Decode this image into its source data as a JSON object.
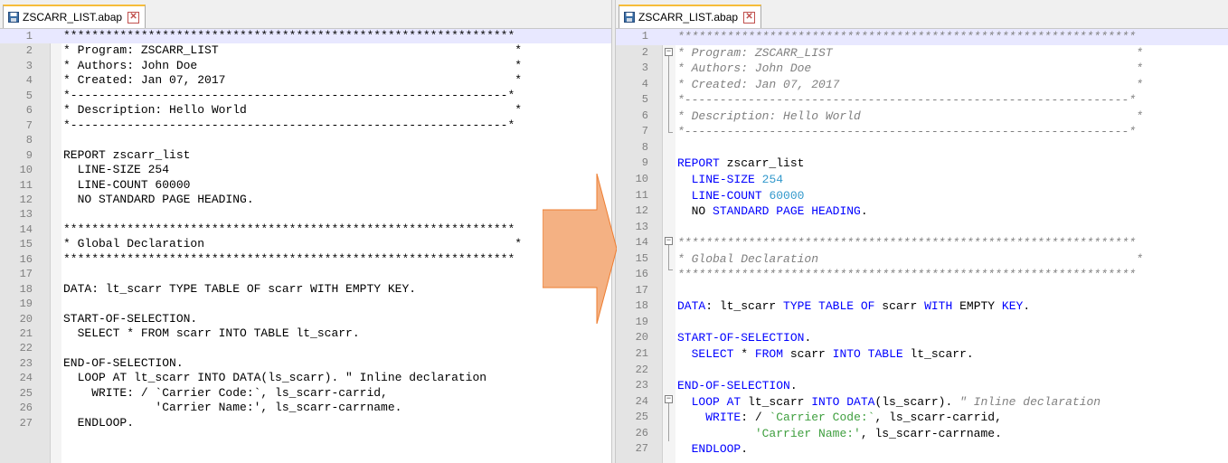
{
  "left": {
    "tab_label": "ZSCARR_LIST.abap",
    "lines": [
      {
        "n": "1",
        "spans": [
          {
            "c": "plain",
            "t": "****************************************************************"
          }
        ]
      },
      {
        "n": "2",
        "spans": [
          {
            "c": "plain",
            "t": "* Program: ZSCARR_LIST                                          *"
          }
        ]
      },
      {
        "n": "3",
        "spans": [
          {
            "c": "plain",
            "t": "* Authors: John Doe                                             *"
          }
        ]
      },
      {
        "n": "4",
        "spans": [
          {
            "c": "plain",
            "t": "* Created: Jan 07, 2017                                         *"
          }
        ]
      },
      {
        "n": "5",
        "spans": [
          {
            "c": "plain",
            "t": "*--------------------------------------------------------------*"
          }
        ]
      },
      {
        "n": "6",
        "spans": [
          {
            "c": "plain",
            "t": "* Description: Hello World                                      *"
          }
        ]
      },
      {
        "n": "7",
        "spans": [
          {
            "c": "plain",
            "t": "*--------------------------------------------------------------*"
          }
        ]
      },
      {
        "n": "8",
        "spans": []
      },
      {
        "n": "9",
        "spans": [
          {
            "c": "plain",
            "t": "REPORT zscarr_list"
          }
        ]
      },
      {
        "n": "10",
        "spans": [
          {
            "c": "plain",
            "t": "  LINE-SIZE 254"
          }
        ]
      },
      {
        "n": "11",
        "spans": [
          {
            "c": "plain",
            "t": "  LINE-COUNT 60000"
          }
        ]
      },
      {
        "n": "12",
        "spans": [
          {
            "c": "plain",
            "t": "  NO STANDARD PAGE HEADING."
          }
        ]
      },
      {
        "n": "13",
        "spans": []
      },
      {
        "n": "14",
        "spans": [
          {
            "c": "plain",
            "t": "****************************************************************"
          }
        ]
      },
      {
        "n": "15",
        "spans": [
          {
            "c": "plain",
            "t": "* Global Declaration                                            *"
          }
        ]
      },
      {
        "n": "16",
        "spans": [
          {
            "c": "plain",
            "t": "****************************************************************"
          }
        ]
      },
      {
        "n": "17",
        "spans": []
      },
      {
        "n": "18",
        "spans": [
          {
            "c": "plain",
            "t": "DATA: lt_scarr TYPE TABLE OF scarr WITH EMPTY KEY."
          }
        ]
      },
      {
        "n": "19",
        "spans": []
      },
      {
        "n": "20",
        "spans": [
          {
            "c": "plain",
            "t": "START-OF-SELECTION."
          }
        ]
      },
      {
        "n": "21",
        "spans": [
          {
            "c": "plain",
            "t": "  SELECT * FROM scarr INTO TABLE lt_scarr."
          }
        ]
      },
      {
        "n": "22",
        "spans": []
      },
      {
        "n": "23",
        "spans": [
          {
            "c": "plain",
            "t": "END-OF-SELECTION."
          }
        ]
      },
      {
        "n": "24",
        "spans": [
          {
            "c": "plain",
            "t": "  LOOP AT lt_scarr INTO DATA(ls_scarr). \" Inline declaration"
          }
        ]
      },
      {
        "n": "25",
        "spans": [
          {
            "c": "plain",
            "t": "    WRITE: / `Carrier Code:`, ls_scarr-carrid,"
          }
        ]
      },
      {
        "n": "26",
        "spans": [
          {
            "c": "plain",
            "t": "             'Carrier Name:', ls_scarr-carrname."
          }
        ]
      },
      {
        "n": "27",
        "spans": [
          {
            "c": "plain",
            "t": "  ENDLOOP."
          }
        ]
      }
    ]
  },
  "right": {
    "tab_label": "ZSCARR_LIST.abap",
    "lines": [
      {
        "n": "1",
        "spans": [
          {
            "c": "cmt",
            "t": "*****************************************************************"
          }
        ]
      },
      {
        "n": "2",
        "spans": [
          {
            "c": "cmt",
            "t": "* Program: ZSCARR_LIST                                           *"
          }
        ]
      },
      {
        "n": "3",
        "spans": [
          {
            "c": "cmt",
            "t": "* Authors: John Doe                                              *"
          }
        ]
      },
      {
        "n": "4",
        "spans": [
          {
            "c": "cmt",
            "t": "* Created: Jan 07, 2017                                          *"
          }
        ]
      },
      {
        "n": "5",
        "spans": [
          {
            "c": "cmt",
            "t": "*---------------------------------------------------------------*"
          }
        ]
      },
      {
        "n": "6",
        "spans": [
          {
            "c": "cmt",
            "t": "* Description: Hello World                                       *"
          }
        ]
      },
      {
        "n": "7",
        "spans": [
          {
            "c": "cmt",
            "t": "*---------------------------------------------------------------*"
          }
        ]
      },
      {
        "n": "8",
        "spans": []
      },
      {
        "n": "9",
        "spans": [
          {
            "c": "kw",
            "t": "REPORT"
          },
          {
            "c": "plain",
            "t": " zscarr_list"
          }
        ]
      },
      {
        "n": "10",
        "spans": [
          {
            "c": "plain",
            "t": "  "
          },
          {
            "c": "kw",
            "t": "LINE-SIZE"
          },
          {
            "c": "plain",
            "t": " "
          },
          {
            "c": "num",
            "t": "254"
          }
        ]
      },
      {
        "n": "11",
        "spans": [
          {
            "c": "plain",
            "t": "  "
          },
          {
            "c": "kw",
            "t": "LINE-COUNT"
          },
          {
            "c": "plain",
            "t": " "
          },
          {
            "c": "num",
            "t": "60000"
          }
        ]
      },
      {
        "n": "12",
        "spans": [
          {
            "c": "plain",
            "t": "  NO "
          },
          {
            "c": "kw",
            "t": "STANDARD PAGE HEADING"
          },
          {
            "c": "plain",
            "t": "."
          }
        ]
      },
      {
        "n": "13",
        "spans": []
      },
      {
        "n": "14",
        "spans": [
          {
            "c": "cmt",
            "t": "*****************************************************************"
          }
        ]
      },
      {
        "n": "15",
        "spans": [
          {
            "c": "cmt",
            "t": "* Global Declaration                                             *"
          }
        ]
      },
      {
        "n": "16",
        "spans": [
          {
            "c": "cmt",
            "t": "*****************************************************************"
          }
        ]
      },
      {
        "n": "17",
        "spans": []
      },
      {
        "n": "18",
        "spans": [
          {
            "c": "kw",
            "t": "DATA"
          },
          {
            "c": "plain",
            "t": ": lt_scarr "
          },
          {
            "c": "kw",
            "t": "TYPE TABLE OF"
          },
          {
            "c": "plain",
            "t": " scarr "
          },
          {
            "c": "kw",
            "t": "WITH"
          },
          {
            "c": "plain",
            "t": " EMPTY "
          },
          {
            "c": "kw",
            "t": "KEY"
          },
          {
            "c": "plain",
            "t": "."
          }
        ]
      },
      {
        "n": "19",
        "spans": []
      },
      {
        "n": "20",
        "spans": [
          {
            "c": "kw",
            "t": "START-OF-SELECTION"
          },
          {
            "c": "plain",
            "t": "."
          }
        ]
      },
      {
        "n": "21",
        "spans": [
          {
            "c": "plain",
            "t": "  "
          },
          {
            "c": "kw",
            "t": "SELECT"
          },
          {
            "c": "plain",
            "t": " * "
          },
          {
            "c": "kw",
            "t": "FROM"
          },
          {
            "c": "plain",
            "t": " scarr "
          },
          {
            "c": "kw",
            "t": "INTO TABLE"
          },
          {
            "c": "plain",
            "t": " lt_scarr."
          }
        ]
      },
      {
        "n": "22",
        "spans": []
      },
      {
        "n": "23",
        "spans": [
          {
            "c": "kw",
            "t": "END-OF-SELECTION"
          },
          {
            "c": "plain",
            "t": "."
          }
        ]
      },
      {
        "n": "24",
        "spans": [
          {
            "c": "plain",
            "t": "  "
          },
          {
            "c": "kw",
            "t": "LOOP AT"
          },
          {
            "c": "plain",
            "t": " lt_scarr "
          },
          {
            "c": "kw",
            "t": "INTO DATA"
          },
          {
            "c": "plain",
            "t": "(ls_scarr). "
          },
          {
            "c": "cmt",
            "t": "\" Inline declaration"
          }
        ]
      },
      {
        "n": "25",
        "spans": [
          {
            "c": "plain",
            "t": "    "
          },
          {
            "c": "kw",
            "t": "WRITE"
          },
          {
            "c": "plain",
            "t": ": / "
          },
          {
            "c": "str",
            "t": "`Carrier Code:`"
          },
          {
            "c": "plain",
            "t": ", ls_scarr-carrid,"
          }
        ]
      },
      {
        "n": "26",
        "spans": [
          {
            "c": "plain",
            "t": "           "
          },
          {
            "c": "str",
            "t": "'Carrier Name:'"
          },
          {
            "c": "plain",
            "t": ", ls_scarr-carrname."
          }
        ]
      },
      {
        "n": "27",
        "spans": [
          {
            "c": "plain",
            "t": "  "
          },
          {
            "c": "kw",
            "t": "ENDLOOP"
          },
          {
            "c": "plain",
            "t": "."
          }
        ]
      }
    ]
  },
  "colors": {
    "keyword": "#0000ff",
    "number": "#3399cc",
    "string": "#3f9f3f",
    "comment": "#808080",
    "arrow_fill": "#f4b183",
    "arrow_stroke": "#ed7d31",
    "tab_accent": "#f6bd3a"
  },
  "icons": {
    "tab_file": "save-disk-icon",
    "tab_close": "close-icon",
    "fold_open": "minus-box",
    "transform": "right-arrow"
  }
}
